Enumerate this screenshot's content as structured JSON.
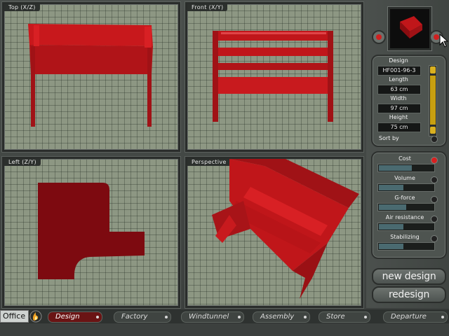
{
  "viewports": {
    "top": {
      "label": "Top (X/Z)"
    },
    "front": {
      "label": "Front (X/Y)"
    },
    "left": {
      "label": "Left (Z/Y)"
    },
    "perspective": {
      "label": "Perspective"
    }
  },
  "design_panel": {
    "design_label": "Design",
    "design_value": "HF001-96-3",
    "length_label": "Length",
    "length_value": "63 cm",
    "width_label": "Width",
    "width_value": "97 cm",
    "height_label": "Height",
    "height_value": "75 cm",
    "sort_label": "Sort by"
  },
  "metrics": [
    {
      "label": "Cost",
      "level": 0.6
    },
    {
      "label": "Volume",
      "level": 0.45
    },
    {
      "label": "G-force",
      "level": 0.5
    },
    {
      "label": "Air resistance",
      "level": 0.45
    },
    {
      "label": "Stabilizing",
      "level": 0.45
    }
  ],
  "buttons": {
    "new_design": "new design",
    "redesign": "redesign"
  },
  "bottom_tabs": {
    "office": "Office",
    "design": "Design",
    "factory": "Factory",
    "windtunnel": "Windtunnel",
    "assembly": "Assembly",
    "store": "Store",
    "departure": "Departure"
  },
  "colors": {
    "model_red": "#c0161a",
    "model_dark": "#7a0a10",
    "grid_bg": "#8d9783",
    "accent_yellow": "#c8a010"
  },
  "icons": [
    "flame-icon",
    "arrow-left-icon",
    "arrow-right-icon",
    "mouse-cursor-icon"
  ]
}
